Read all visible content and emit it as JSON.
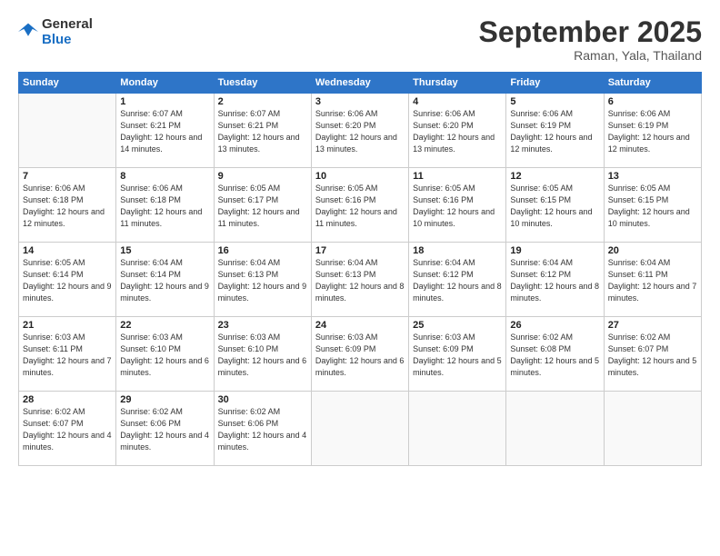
{
  "header": {
    "logo_general": "General",
    "logo_blue": "Blue",
    "month": "September 2025",
    "location": "Raman, Yala, Thailand"
  },
  "days_of_week": [
    "Sunday",
    "Monday",
    "Tuesday",
    "Wednesday",
    "Thursday",
    "Friday",
    "Saturday"
  ],
  "weeks": [
    [
      {
        "day": "",
        "sunrise": "",
        "sunset": "",
        "daylight": ""
      },
      {
        "day": "1",
        "sunrise": "6:07 AM",
        "sunset": "6:21 PM",
        "daylight": "12 hours and 14 minutes."
      },
      {
        "day": "2",
        "sunrise": "6:07 AM",
        "sunset": "6:21 PM",
        "daylight": "12 hours and 13 minutes."
      },
      {
        "day": "3",
        "sunrise": "6:06 AM",
        "sunset": "6:20 PM",
        "daylight": "12 hours and 13 minutes."
      },
      {
        "day": "4",
        "sunrise": "6:06 AM",
        "sunset": "6:20 PM",
        "daylight": "12 hours and 13 minutes."
      },
      {
        "day": "5",
        "sunrise": "6:06 AM",
        "sunset": "6:19 PM",
        "daylight": "12 hours and 12 minutes."
      },
      {
        "day": "6",
        "sunrise": "6:06 AM",
        "sunset": "6:19 PM",
        "daylight": "12 hours and 12 minutes."
      }
    ],
    [
      {
        "day": "7",
        "sunrise": "6:06 AM",
        "sunset": "6:18 PM",
        "daylight": "12 hours and 12 minutes."
      },
      {
        "day": "8",
        "sunrise": "6:06 AM",
        "sunset": "6:18 PM",
        "daylight": "12 hours and 11 minutes."
      },
      {
        "day": "9",
        "sunrise": "6:05 AM",
        "sunset": "6:17 PM",
        "daylight": "12 hours and 11 minutes."
      },
      {
        "day": "10",
        "sunrise": "6:05 AM",
        "sunset": "6:16 PM",
        "daylight": "12 hours and 11 minutes."
      },
      {
        "day": "11",
        "sunrise": "6:05 AM",
        "sunset": "6:16 PM",
        "daylight": "12 hours and 10 minutes."
      },
      {
        "day": "12",
        "sunrise": "6:05 AM",
        "sunset": "6:15 PM",
        "daylight": "12 hours and 10 minutes."
      },
      {
        "day": "13",
        "sunrise": "6:05 AM",
        "sunset": "6:15 PM",
        "daylight": "12 hours and 10 minutes."
      }
    ],
    [
      {
        "day": "14",
        "sunrise": "6:05 AM",
        "sunset": "6:14 PM",
        "daylight": "12 hours and 9 minutes."
      },
      {
        "day": "15",
        "sunrise": "6:04 AM",
        "sunset": "6:14 PM",
        "daylight": "12 hours and 9 minutes."
      },
      {
        "day": "16",
        "sunrise": "6:04 AM",
        "sunset": "6:13 PM",
        "daylight": "12 hours and 9 minutes."
      },
      {
        "day": "17",
        "sunrise": "6:04 AM",
        "sunset": "6:13 PM",
        "daylight": "12 hours and 8 minutes."
      },
      {
        "day": "18",
        "sunrise": "6:04 AM",
        "sunset": "6:12 PM",
        "daylight": "12 hours and 8 minutes."
      },
      {
        "day": "19",
        "sunrise": "6:04 AM",
        "sunset": "6:12 PM",
        "daylight": "12 hours and 8 minutes."
      },
      {
        "day": "20",
        "sunrise": "6:04 AM",
        "sunset": "6:11 PM",
        "daylight": "12 hours and 7 minutes."
      }
    ],
    [
      {
        "day": "21",
        "sunrise": "6:03 AM",
        "sunset": "6:11 PM",
        "daylight": "12 hours and 7 minutes."
      },
      {
        "day": "22",
        "sunrise": "6:03 AM",
        "sunset": "6:10 PM",
        "daylight": "12 hours and 6 minutes."
      },
      {
        "day": "23",
        "sunrise": "6:03 AM",
        "sunset": "6:10 PM",
        "daylight": "12 hours and 6 minutes."
      },
      {
        "day": "24",
        "sunrise": "6:03 AM",
        "sunset": "6:09 PM",
        "daylight": "12 hours and 6 minutes."
      },
      {
        "day": "25",
        "sunrise": "6:03 AM",
        "sunset": "6:09 PM",
        "daylight": "12 hours and 5 minutes."
      },
      {
        "day": "26",
        "sunrise": "6:02 AM",
        "sunset": "6:08 PM",
        "daylight": "12 hours and 5 minutes."
      },
      {
        "day": "27",
        "sunrise": "6:02 AM",
        "sunset": "6:07 PM",
        "daylight": "12 hours and 5 minutes."
      }
    ],
    [
      {
        "day": "28",
        "sunrise": "6:02 AM",
        "sunset": "6:07 PM",
        "daylight": "12 hours and 4 minutes."
      },
      {
        "day": "29",
        "sunrise": "6:02 AM",
        "sunset": "6:06 PM",
        "daylight": "12 hours and 4 minutes."
      },
      {
        "day": "30",
        "sunrise": "6:02 AM",
        "sunset": "6:06 PM",
        "daylight": "12 hours and 4 minutes."
      },
      {
        "day": "",
        "sunrise": "",
        "sunset": "",
        "daylight": ""
      },
      {
        "day": "",
        "sunrise": "",
        "sunset": "",
        "daylight": ""
      },
      {
        "day": "",
        "sunrise": "",
        "sunset": "",
        "daylight": ""
      },
      {
        "day": "",
        "sunrise": "",
        "sunset": "",
        "daylight": ""
      }
    ]
  ]
}
